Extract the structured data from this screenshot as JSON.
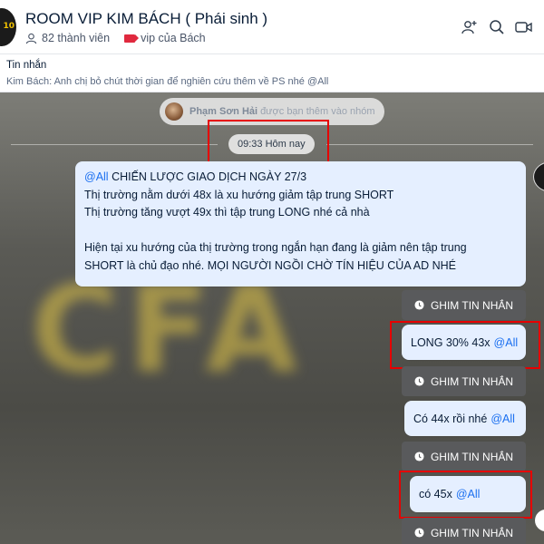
{
  "header": {
    "avatar_text": "10",
    "title": "ROOM VIP KIM BÁCH ( Phái sinh )",
    "members": "82 thành viên",
    "tag_label": "vip của Bách",
    "buttons": [
      "add-member-icon",
      "search-icon",
      "video-call-icon"
    ]
  },
  "pinned": {
    "title": "Tin nhắn",
    "text": "Kim Bách: Anh chị bỏ chút thời gian để nghiên cứu thêm về PS nhé @All"
  },
  "chat": {
    "notice_name": "Phạm Sơn Hải",
    "notice_text": "được bạn thêm vào nhóm",
    "time_divider": "09:33 Hôm nay",
    "watermark": "CFA",
    "main_message": {
      "mention": "@All",
      "line1": " CHIẾN LƯỢC GIAO DỊCH NGÀY 27/3",
      "line2": "Thị trường nằm dưới 48x là xu hướng giảm tập trung SHORT",
      "line3": "Thị trường tăng vượt 49x thì tập trung LONG nhé cả nhà",
      "line4": "Hiện tại xu hướng của thị trường trong ngắn hạn đang là giảm nên tập trung",
      "line5": "SHORT là chủ đạo nhé. MỌI NGƯỜI NGỒI CHỜ TÍN HIỆU CỦA AD NHÉ"
    },
    "pin_label": "GHIM TIN NHẮN",
    "msg1": {
      "text": "LONG 30% 43x ",
      "mention": "@All"
    },
    "msg2": {
      "text": "Có 44x rồi nhé ",
      "mention": "@All"
    },
    "msg3": {
      "text": "có 45x ",
      "mention": "@All"
    },
    "accent_color": "#1a6ff0",
    "highlight_color": "#e60000"
  }
}
